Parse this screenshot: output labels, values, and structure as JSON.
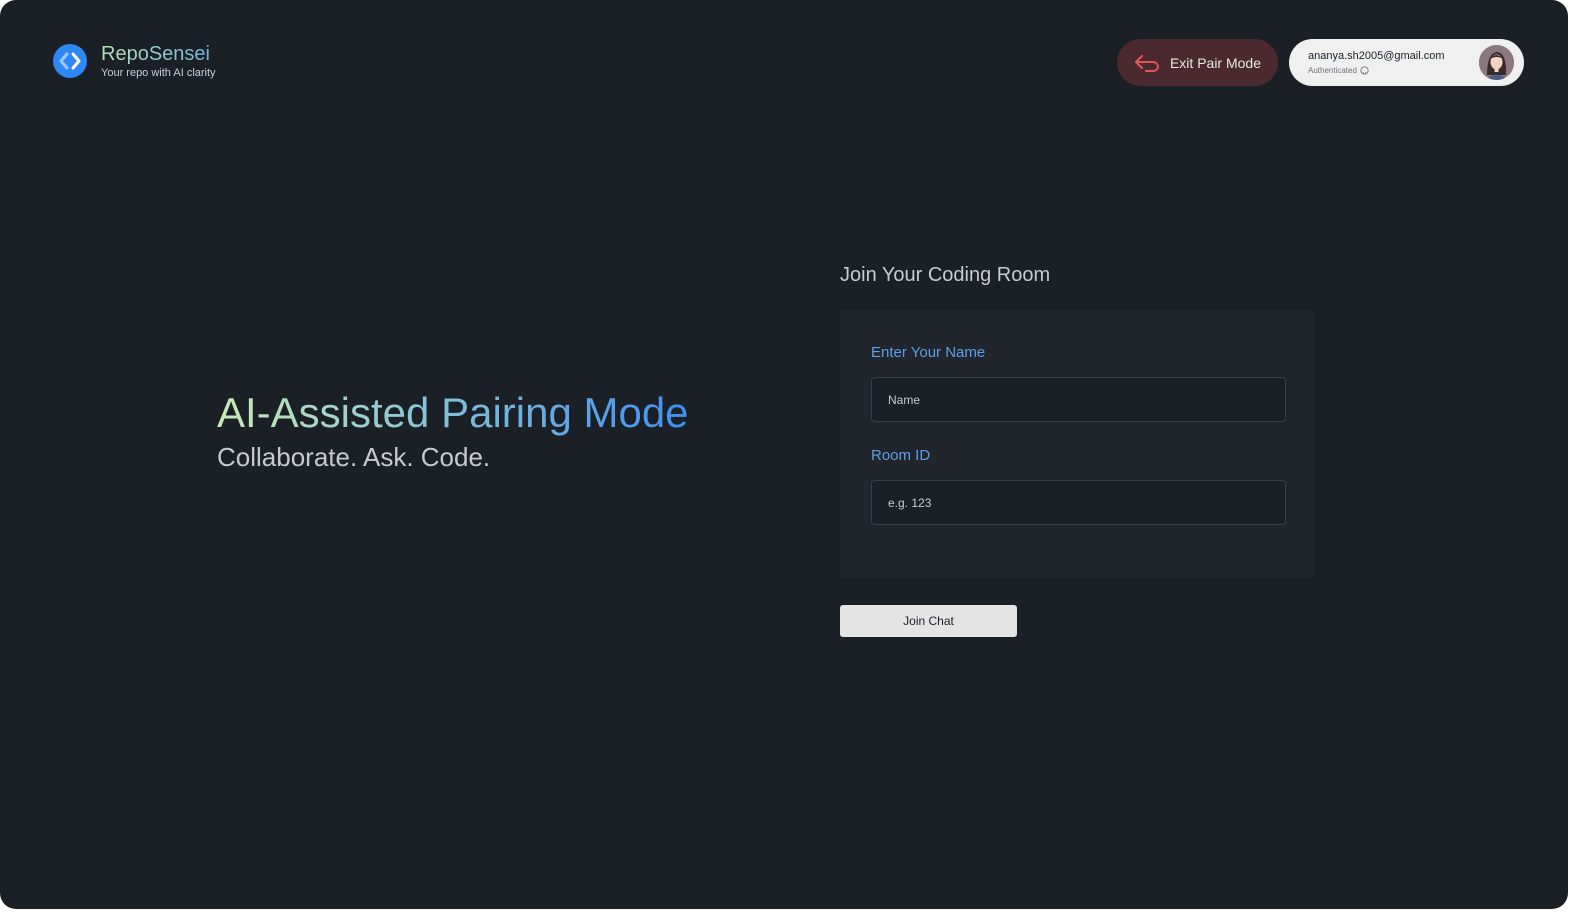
{
  "brand": {
    "name": "RepoSensei",
    "tagline": "Your repo with AI clarity",
    "logo_icon": "code-chevrons-icon",
    "accent": "#2d88f4"
  },
  "header": {
    "exit_label": "Exit Pair Mode",
    "exit_icon": "undo-arrow-icon",
    "exit_icon_color": "#e05555"
  },
  "user": {
    "email": "ananya.sh2005@gmail.com",
    "status": "Authenticated",
    "status_icon": "github-icon"
  },
  "hero": {
    "title": "AI-Assisted Pairing Mode",
    "subtitle": "Collaborate. Ask. Code."
  },
  "form": {
    "title": "Join Your Coding Room",
    "name_label": "Enter Your Name",
    "name_placeholder": "Name",
    "room_label": "Room ID",
    "room_placeholder": "e.g. 123",
    "submit_label": "Join Chat"
  }
}
